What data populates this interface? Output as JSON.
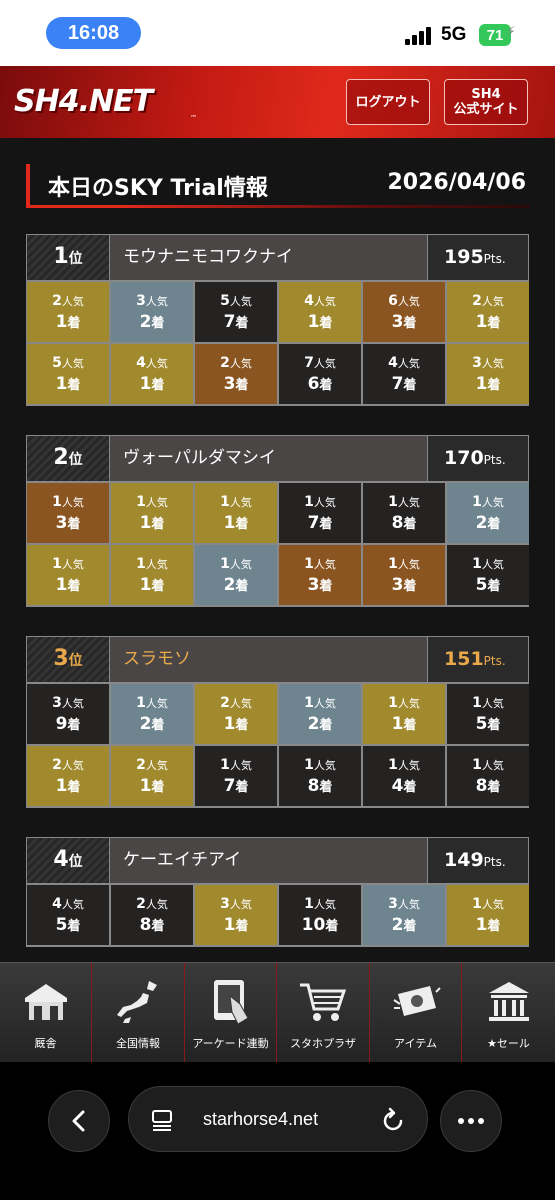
{
  "status_bar": {
    "time": "16:08",
    "network": "5G",
    "battery": "71"
  },
  "header": {
    "logo": "SH4.NET",
    "logout_label": "ログアウト",
    "site_line1": "SH4",
    "site_line2": "公式サイト"
  },
  "page": {
    "title": "本日のSKY Trial情報",
    "date": "2026/04/06"
  },
  "labels": {
    "rank_suffix": "位",
    "pts_suffix": "Pts.",
    "pop_suffix": "人気",
    "finish_suffix": "着"
  },
  "rankings": [
    {
      "rank": "1",
      "name": "モウナニモコワクナイ",
      "pts": "195",
      "highlight": false,
      "results": [
        {
          "pop": "2",
          "fin": "1",
          "color": "gold"
        },
        {
          "pop": "3",
          "fin": "2",
          "color": "blue"
        },
        {
          "pop": "5",
          "fin": "7",
          "color": "black"
        },
        {
          "pop": "4",
          "fin": "1",
          "color": "gold"
        },
        {
          "pop": "6",
          "fin": "3",
          "color": "brown"
        },
        {
          "pop": "2",
          "fin": "1",
          "color": "gold"
        },
        {
          "pop": "5",
          "fin": "1",
          "color": "gold"
        },
        {
          "pop": "4",
          "fin": "1",
          "color": "gold"
        },
        {
          "pop": "2",
          "fin": "3",
          "color": "brown"
        },
        {
          "pop": "7",
          "fin": "6",
          "color": "black"
        },
        {
          "pop": "4",
          "fin": "7",
          "color": "black"
        },
        {
          "pop": "3",
          "fin": "1",
          "color": "gold"
        }
      ]
    },
    {
      "rank": "2",
      "name": "ヴォーパルダマシイ",
      "pts": "170",
      "highlight": false,
      "results": [
        {
          "pop": "1",
          "fin": "3",
          "color": "brown"
        },
        {
          "pop": "1",
          "fin": "1",
          "color": "gold"
        },
        {
          "pop": "1",
          "fin": "1",
          "color": "gold"
        },
        {
          "pop": "1",
          "fin": "7",
          "color": "black"
        },
        {
          "pop": "1",
          "fin": "8",
          "color": "black"
        },
        {
          "pop": "1",
          "fin": "2",
          "color": "blue"
        },
        {
          "pop": "1",
          "fin": "1",
          "color": "gold"
        },
        {
          "pop": "1",
          "fin": "1",
          "color": "gold"
        },
        {
          "pop": "1",
          "fin": "2",
          "color": "blue"
        },
        {
          "pop": "1",
          "fin": "3",
          "color": "brown"
        },
        {
          "pop": "1",
          "fin": "3",
          "color": "brown"
        },
        {
          "pop": "1",
          "fin": "5",
          "color": "black"
        }
      ]
    },
    {
      "rank": "3",
      "name": "スラモソ",
      "pts": "151",
      "highlight": true,
      "results": [
        {
          "pop": "3",
          "fin": "9",
          "color": "black"
        },
        {
          "pop": "1",
          "fin": "2",
          "color": "blue"
        },
        {
          "pop": "2",
          "fin": "1",
          "color": "gold"
        },
        {
          "pop": "1",
          "fin": "2",
          "color": "blue"
        },
        {
          "pop": "1",
          "fin": "1",
          "color": "gold"
        },
        {
          "pop": "1",
          "fin": "5",
          "color": "black"
        },
        {
          "pop": "2",
          "fin": "1",
          "color": "gold"
        },
        {
          "pop": "2",
          "fin": "1",
          "color": "gold"
        },
        {
          "pop": "1",
          "fin": "7",
          "color": "black"
        },
        {
          "pop": "1",
          "fin": "8",
          "color": "black"
        },
        {
          "pop": "1",
          "fin": "4",
          "color": "black"
        },
        {
          "pop": "1",
          "fin": "8",
          "color": "black"
        }
      ]
    },
    {
      "rank": "4",
      "name": "ケーエイチアイ",
      "pts": "149",
      "highlight": false,
      "results": [
        {
          "pop": "4",
          "fin": "5",
          "color": "black"
        },
        {
          "pop": "2",
          "fin": "8",
          "color": "black"
        },
        {
          "pop": "3",
          "fin": "1",
          "color": "gold"
        },
        {
          "pop": "1",
          "fin": "10",
          "color": "black"
        },
        {
          "pop": "3",
          "fin": "2",
          "color": "blue"
        },
        {
          "pop": "1",
          "fin": "1",
          "color": "gold"
        }
      ]
    }
  ],
  "bottom_nav": [
    {
      "label": "厩舎",
      "icon": "stable-icon"
    },
    {
      "label": "全国情報",
      "icon": "japan-map-icon"
    },
    {
      "label": "アーケード連動",
      "icon": "arcade-tablet-icon"
    },
    {
      "label": "スタホプラザ",
      "icon": "shopping-cart-icon"
    },
    {
      "label": "アイテム",
      "icon": "ticket-icon"
    },
    {
      "label": "★セール",
      "icon": "museum-icon"
    }
  ],
  "browser": {
    "url": "starhorse4.net"
  }
}
